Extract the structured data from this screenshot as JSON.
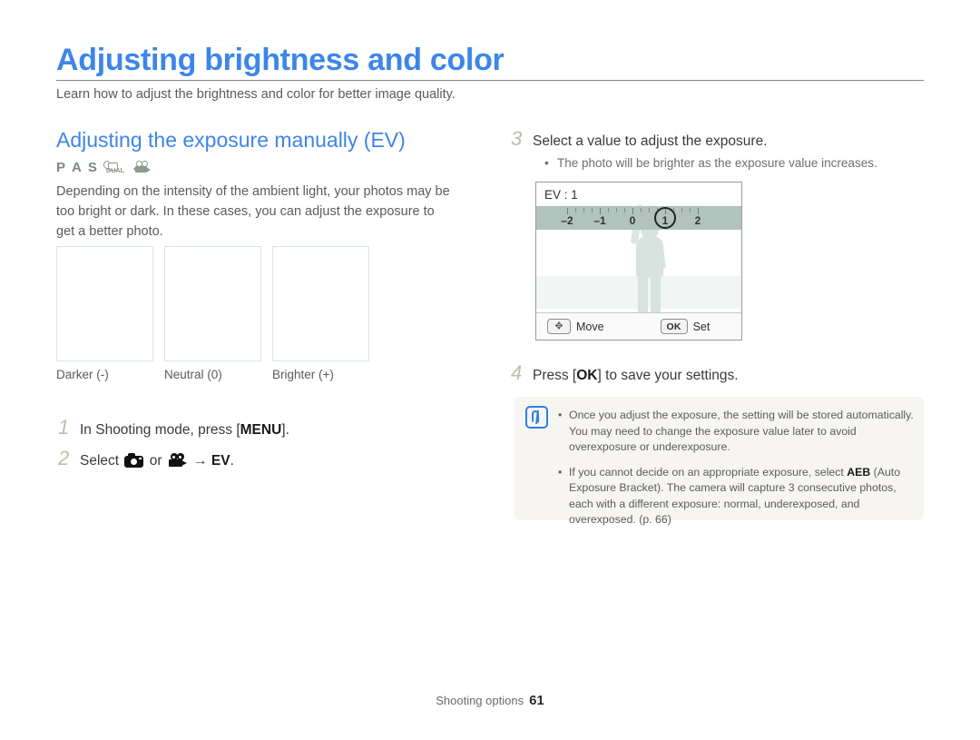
{
  "header": {
    "title": "Adjusting brightness and color",
    "subtitle": "Learn how to adjust the brightness and color for better image quality.",
    "accent_color": "#3d86e8",
    "rule_color": "#8f8279"
  },
  "left_column": {
    "section_title": "Adjusting the exposure manually (EV)",
    "mode_icons": [
      {
        "name": "mode-p",
        "label": "P"
      },
      {
        "name": "mode-a",
        "label": "A"
      },
      {
        "name": "mode-s",
        "label": "S"
      },
      {
        "name": "mode-dual-is",
        "label": "DUAL"
      },
      {
        "name": "mode-movie",
        "label": ""
      }
    ],
    "intro_paragraph": "Depending on the intensity of the ambient light, your photos may be too bright or dark. In these cases, you can adjust the exposure to get a better photo.",
    "samples": [
      {
        "caption": "Darker (-)"
      },
      {
        "caption": "Neutral (0)"
      },
      {
        "caption": "Brighter (+)"
      }
    ],
    "steps": [
      {
        "number": "1",
        "pre": "In Shooting mode, press [",
        "bold": "MENU",
        "post": "]."
      },
      {
        "number": "2",
        "pre": "Select ",
        "mid_or": " or ",
        "arrow": " → ",
        "bold": "EV",
        "post": "."
      }
    ]
  },
  "right_column": {
    "step3": {
      "number": "3",
      "text": "Select a value to adjust the exposure.",
      "bullet": "The photo will be brighter as the exposure value increases."
    },
    "step4": {
      "number": "4",
      "pre": "Press [",
      "bold": "OK",
      "post": "] to save your settings."
    },
    "lcd": {
      "ev_label": "EV : 1",
      "scale_values": [
        "–2",
        "–1",
        "0",
        "1",
        "2"
      ],
      "selected_value": "1",
      "bar_color": "#b2c2bd",
      "move_label": "Move",
      "move_key": "✥",
      "set_label": "Set",
      "ok_key": "OK"
    },
    "note": {
      "icon": "note-pen-icon",
      "icon_color": "#2f7fe8",
      "items": [
        {
          "text": "Once you adjust the exposure, the setting will be stored automatically. You may need to change the exposure value later to avoid overexposure or underexposure."
        },
        {
          "pre": "If you cannot decide on an appropriate exposure, select ",
          "bold": "AEB",
          "post": " (Auto Exposure Bracket). The camera will capture 3 consecutive photos, each with a different exposure: normal, underexposed, and overexposed. (p. 66)"
        }
      ]
    }
  },
  "footer": {
    "section": "Shooting options",
    "page_number": "61"
  }
}
